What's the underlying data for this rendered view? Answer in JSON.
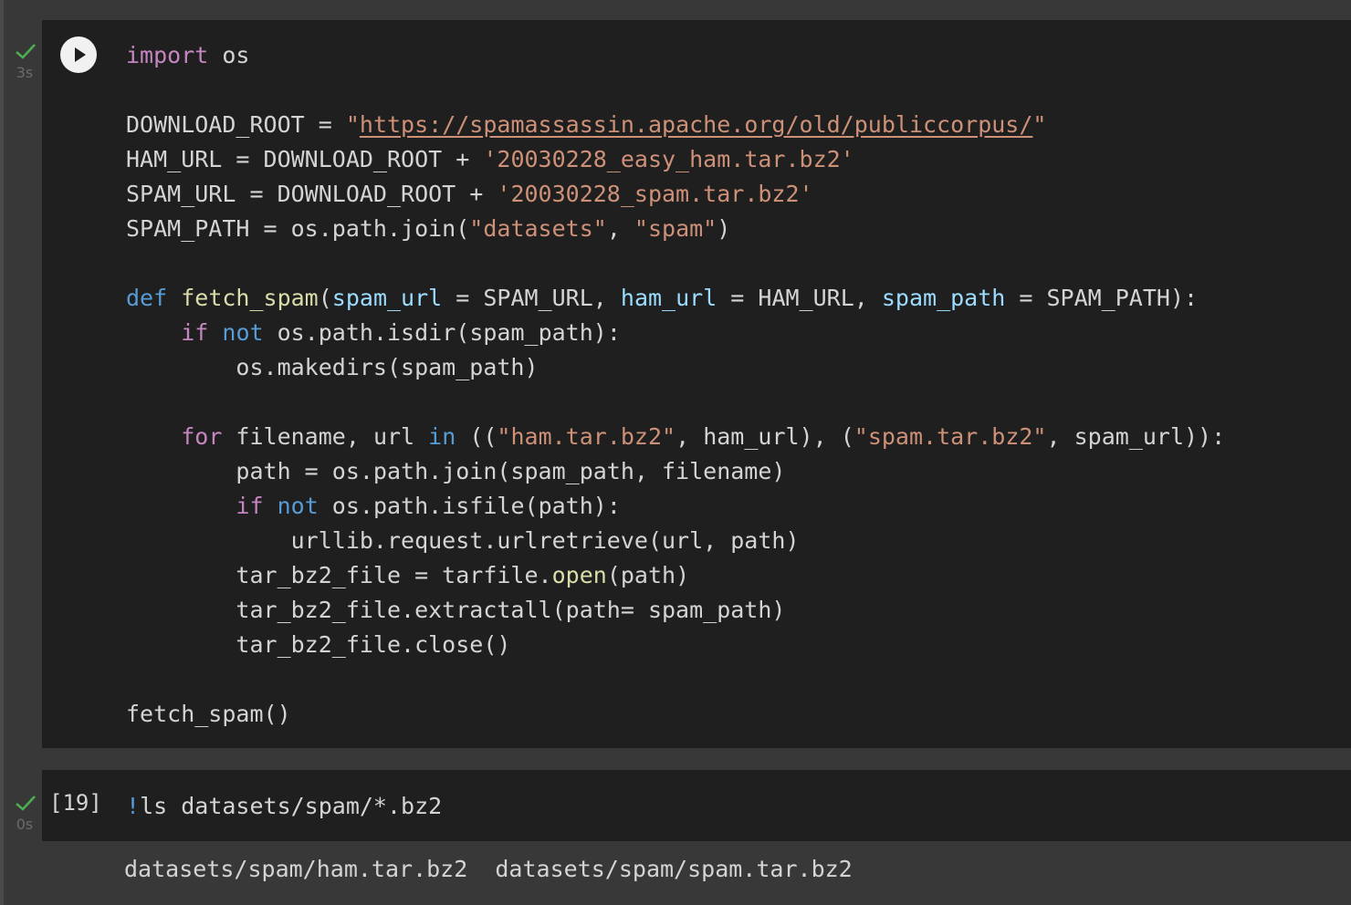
{
  "cells": [
    {
      "status": "success",
      "time": "3s",
      "run_label": "Run cell",
      "code_lines": [
        [
          {
            "t": "import",
            "c": "kw"
          },
          {
            "t": " os",
            "c": ""
          }
        ],
        [],
        [
          {
            "t": "DOWNLOAD_ROOT = ",
            "c": ""
          },
          {
            "t": "\"",
            "c": "str"
          },
          {
            "t": "https://spamassassin.apache.org/old/publiccorpus/",
            "c": "url"
          },
          {
            "t": "\"",
            "c": "str"
          }
        ],
        [
          {
            "t": "HAM_URL = DOWNLOAD_ROOT + ",
            "c": ""
          },
          {
            "t": "'20030228_easy_ham.tar.bz2'",
            "c": "str"
          }
        ],
        [
          {
            "t": "SPAM_URL = DOWNLOAD_ROOT + ",
            "c": ""
          },
          {
            "t": "'20030228_spam.tar.bz2'",
            "c": "str"
          }
        ],
        [
          {
            "t": "SPAM_PATH = os.path.join(",
            "c": ""
          },
          {
            "t": "\"datasets\"",
            "c": "str"
          },
          {
            "t": ", ",
            "c": ""
          },
          {
            "t": "\"spam\"",
            "c": "str"
          },
          {
            "t": ")",
            "c": ""
          }
        ],
        [],
        [
          {
            "t": "def",
            "c": "kw2"
          },
          {
            "t": " ",
            "c": ""
          },
          {
            "t": "fetch_spam",
            "c": "fn"
          },
          {
            "t": "(",
            "c": ""
          },
          {
            "t": "spam_url",
            "c": "par"
          },
          {
            "t": " = SPAM_URL, ",
            "c": ""
          },
          {
            "t": "ham_url",
            "c": "par"
          },
          {
            "t": " = HAM_URL, ",
            "c": ""
          },
          {
            "t": "spam_path",
            "c": "par"
          },
          {
            "t": " = SPAM_PATH):",
            "c": ""
          }
        ],
        [
          {
            "t": "    ",
            "c": ""
          },
          {
            "t": "if",
            "c": "kw"
          },
          {
            "t": " ",
            "c": ""
          },
          {
            "t": "not",
            "c": "kw2"
          },
          {
            "t": " os.path.isdir(spam_path):",
            "c": ""
          }
        ],
        [
          {
            "t": "        os.makedirs(spam_path)",
            "c": ""
          }
        ],
        [],
        [
          {
            "t": "    ",
            "c": ""
          },
          {
            "t": "for",
            "c": "kw"
          },
          {
            "t": " filename, url ",
            "c": ""
          },
          {
            "t": "in",
            "c": "kw2"
          },
          {
            "t": " ((",
            "c": ""
          },
          {
            "t": "\"ham.tar.bz2\"",
            "c": "str"
          },
          {
            "t": ", ham_url), (",
            "c": ""
          },
          {
            "t": "\"spam.tar.bz2\"",
            "c": "str"
          },
          {
            "t": ", spam_url)):",
            "c": ""
          }
        ],
        [
          {
            "t": "        path = os.path.join(spam_path, filename)",
            "c": ""
          }
        ],
        [
          {
            "t": "        ",
            "c": ""
          },
          {
            "t": "if",
            "c": "kw"
          },
          {
            "t": " ",
            "c": ""
          },
          {
            "t": "not",
            "c": "kw2"
          },
          {
            "t": " os.path.isfile(path):",
            "c": ""
          }
        ],
        [
          {
            "t": "            urllib.request.urlretrieve(url, path)",
            "c": ""
          }
        ],
        [
          {
            "t": "        tar_bz2_file = tarfile.",
            "c": ""
          },
          {
            "t": "open",
            "c": "fn"
          },
          {
            "t": "(path)",
            "c": ""
          }
        ],
        [
          {
            "t": "        tar_bz2_file.extractall(path= spam_path)",
            "c": ""
          }
        ],
        [
          {
            "t": "        tar_bz2_file.close()",
            "c": ""
          }
        ],
        [],
        [
          {
            "t": "fetch_spam()",
            "c": ""
          }
        ]
      ]
    },
    {
      "status": "success",
      "time": "0s",
      "exec_count": "[19]",
      "code_lines": [
        [
          {
            "t": "!",
            "c": "bang"
          },
          {
            "t": "ls datasets/spam/*.bz2",
            "c": ""
          }
        ]
      ],
      "output": "datasets/spam/ham.tar.bz2  datasets/spam/spam.tar.bz2"
    }
  ],
  "colors": {
    "background": "#383838",
    "cell_bg": "#1f1f1f",
    "success_check": "#4caf50",
    "keyword": "#c586c0",
    "keyword_blue": "#569cd6",
    "string": "#ce9178",
    "function": "#dcdcaa",
    "parameter": "#9cdcfe"
  },
  "icons": {
    "status": "checkmark-icon",
    "run": "play-icon"
  }
}
